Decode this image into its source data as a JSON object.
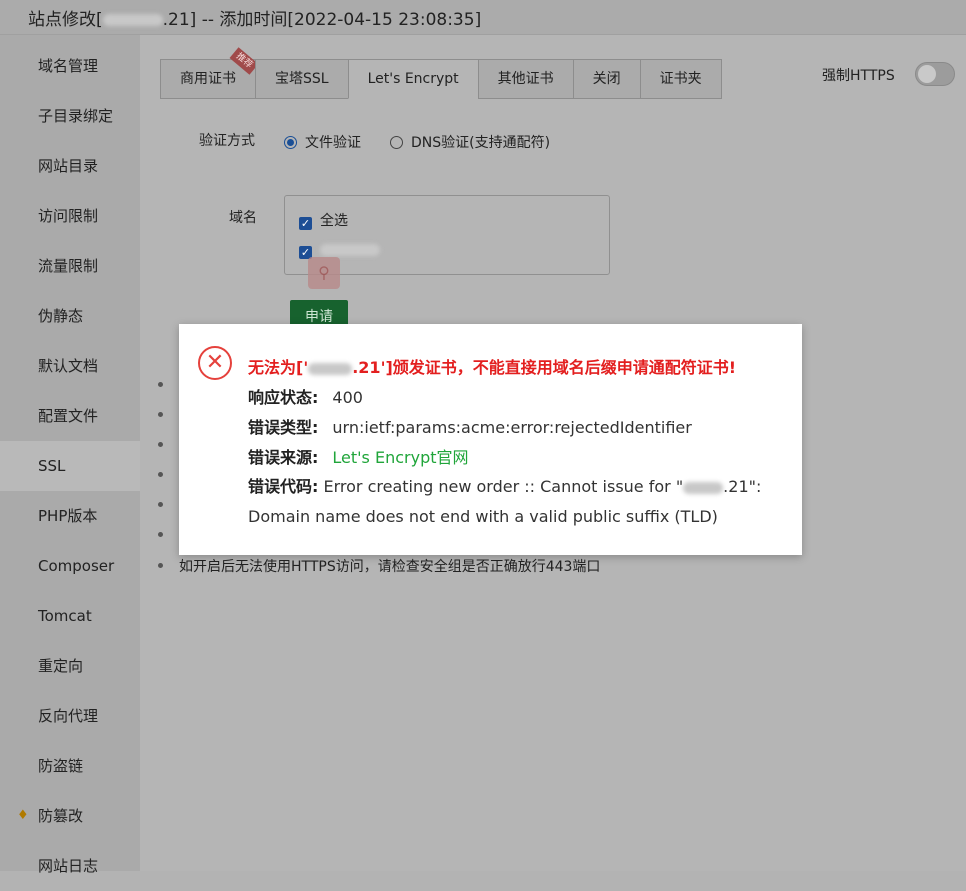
{
  "window": {
    "title_prefix": "站点修改[",
    "title_suffix": ".21] -- 添加时间[2022-04-15 23:08:35]"
  },
  "sidebar": {
    "items": [
      {
        "label": "域名管理"
      },
      {
        "label": "子目录绑定"
      },
      {
        "label": "网站目录"
      },
      {
        "label": "访问限制"
      },
      {
        "label": "流量限制"
      },
      {
        "label": "伪静态"
      },
      {
        "label": "默认文档"
      },
      {
        "label": "配置文件"
      },
      {
        "label": "SSL"
      },
      {
        "label": "PHP版本"
      },
      {
        "label": "Composer"
      },
      {
        "label": "Tomcat"
      },
      {
        "label": "重定向"
      },
      {
        "label": "反向代理"
      },
      {
        "label": "防盗链"
      },
      {
        "label": "防篡改"
      },
      {
        "label": "网站日志"
      }
    ]
  },
  "tabs": [
    {
      "label": "商用证书",
      "badge": "推荐"
    },
    {
      "label": "宝塔SSL"
    },
    {
      "label": "Let's Encrypt"
    },
    {
      "label": "其他证书"
    },
    {
      "label": "关闭"
    },
    {
      "label": "证书夹"
    }
  ],
  "force_https": {
    "label": "强制HTTPS",
    "enabled": false
  },
  "form": {
    "method_label": "验证方式",
    "options": [
      "文件验证",
      "DNS验证(支持通配符)"
    ],
    "domain_label": "域名",
    "select_all": "全选",
    "apply": "申请"
  },
  "last_tip": "如开启后无法使用HTTPS访问，请检查安全组是否正确放行443端口",
  "dialog": {
    "title_before": "无法为['",
    "title_after": ".21']颁发证书，不能直接用域名后缀申请通配符证书!",
    "status_label": "响应状态:",
    "status_value": "400",
    "type_label": "错误类型:",
    "type_value": "urn:ietf:params:acme:error:rejectedIdentifier",
    "source_label": "错误来源:",
    "source_value": "Let's Encrypt官网",
    "code_label": "错误代码:",
    "code_value_a": "Error creating new order :: Cannot issue for \"",
    "code_value_b": ".21\": Domain name does not end with a valid public suffix (TLD)"
  },
  "colors": {
    "error": "#e31f1f",
    "link": "#20a53a",
    "primary": "#1d4e95"
  }
}
